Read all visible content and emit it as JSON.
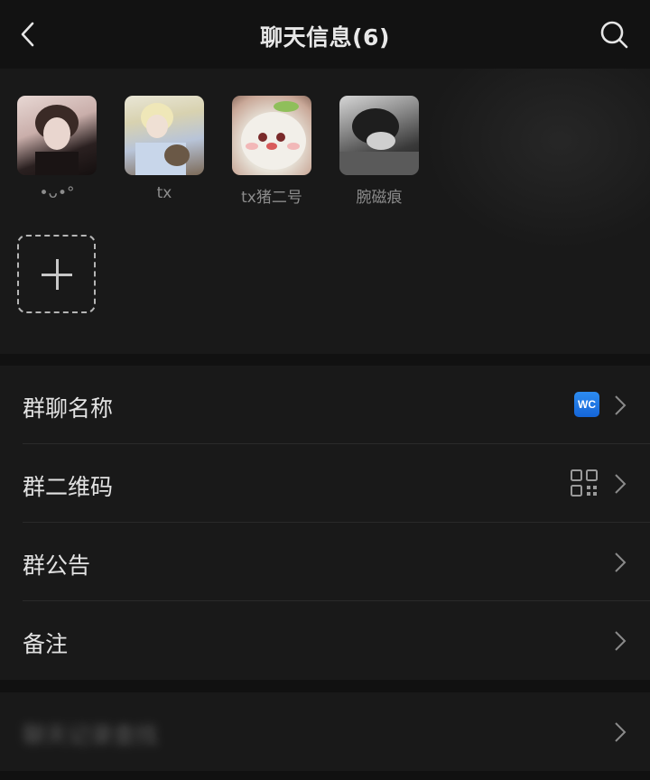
{
  "header": {
    "title": "聊天信息(6)",
    "back_icon": "chevron-left-icon",
    "search_icon": "search-icon"
  },
  "members": [
    {
      "name": "•ᴗ•°",
      "avatar": "photo"
    },
    {
      "name": "tx",
      "avatar": "photo"
    },
    {
      "name": "tx猪二号",
      "avatar": "photo"
    },
    {
      "name": "腕磁痕",
      "avatar": "photo"
    }
  ],
  "add_member": {
    "icon": "plus-icon"
  },
  "settings": {
    "group_name": {
      "label": "群聊名称",
      "badge": "WC"
    },
    "group_qr": {
      "label": "群二维码",
      "icon": "qr-code-icon"
    },
    "announcement": {
      "label": "群公告"
    },
    "remark": {
      "label": "备注"
    }
  },
  "hidden_row": {
    "label": "聊天记录查找"
  },
  "colors": {
    "background": "#111111",
    "panel": "#191919",
    "badge_blue": "#1e78e6",
    "text": "#e2e2e2",
    "muted": "#8c8c8c"
  }
}
